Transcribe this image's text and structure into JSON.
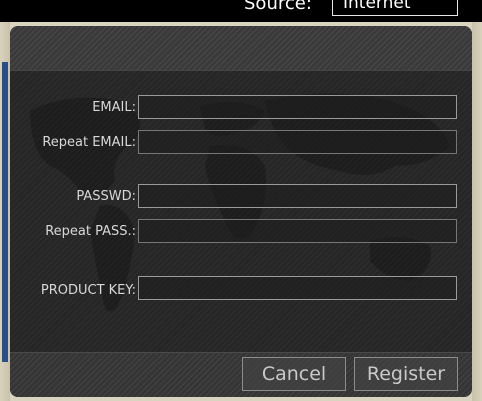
{
  "background": {
    "source_label": "Source:",
    "source_value": "Internet"
  },
  "form": {
    "email_label": "EMAIL:",
    "email_value": "",
    "repeat_email_label": "Repeat EMAIL:",
    "repeat_email_value": "",
    "password_label": "PASSWD:",
    "password_value": "",
    "repeat_password_label": "Repeat PASS.:",
    "repeat_password_value": "",
    "product_key_label": "PRODUCT KEY:",
    "product_key_value": ""
  },
  "buttons": {
    "cancel_label": "Cancel",
    "register_label": "Register"
  },
  "colors": {
    "dialog_bg": "#262626",
    "text": "#d8d8d8",
    "field_border": "#9a9a9a"
  }
}
